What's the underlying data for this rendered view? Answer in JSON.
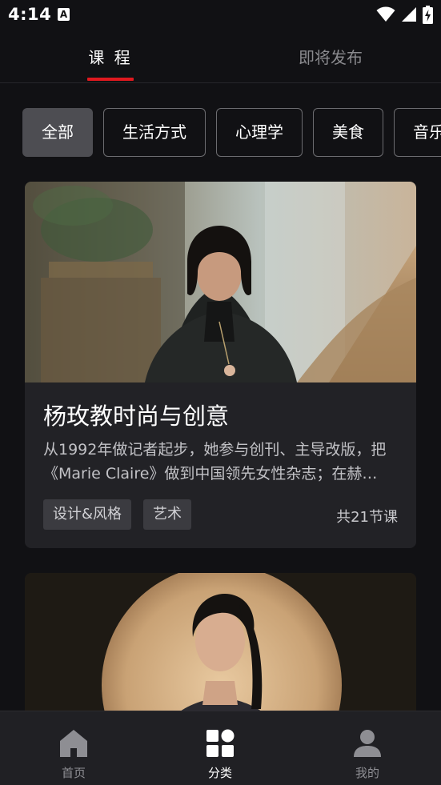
{
  "status_bar": {
    "time": "4:14",
    "notification_icon": "a-letter-icon",
    "icons": [
      "wifi-icon",
      "signal-icon",
      "battery-charging-icon"
    ]
  },
  "top_tabs": [
    {
      "label": "课 程",
      "active": true
    },
    {
      "label": "即将发布",
      "active": false
    }
  ],
  "accent_color": "#e0191f",
  "categories": [
    {
      "label": "全部",
      "selected": true
    },
    {
      "label": "生活方式",
      "selected": false
    },
    {
      "label": "心理学",
      "selected": false
    },
    {
      "label": "美食",
      "selected": false
    },
    {
      "label": "音乐",
      "selected": false
    }
  ],
  "courses": [
    {
      "title": "杨玫教时尚与创意",
      "description_lines": [
        "从1992年做记者起步，她参与创刊、主导改版，把",
        "《Marie Claire》做到中国领先女性杂志；在赫…"
      ],
      "tags": [
        "设计&风格",
        "艺术"
      ],
      "lesson_count": "共21节课",
      "image": "instructor-portrait-photo"
    },
    {
      "image": "instructor-portrait-photo"
    }
  ],
  "bottom_nav": [
    {
      "label": "首页",
      "icon": "home-icon",
      "active": false
    },
    {
      "label": "分类",
      "icon": "grid-icon",
      "active": true
    },
    {
      "label": "我的",
      "icon": "person-icon",
      "active": false
    }
  ]
}
